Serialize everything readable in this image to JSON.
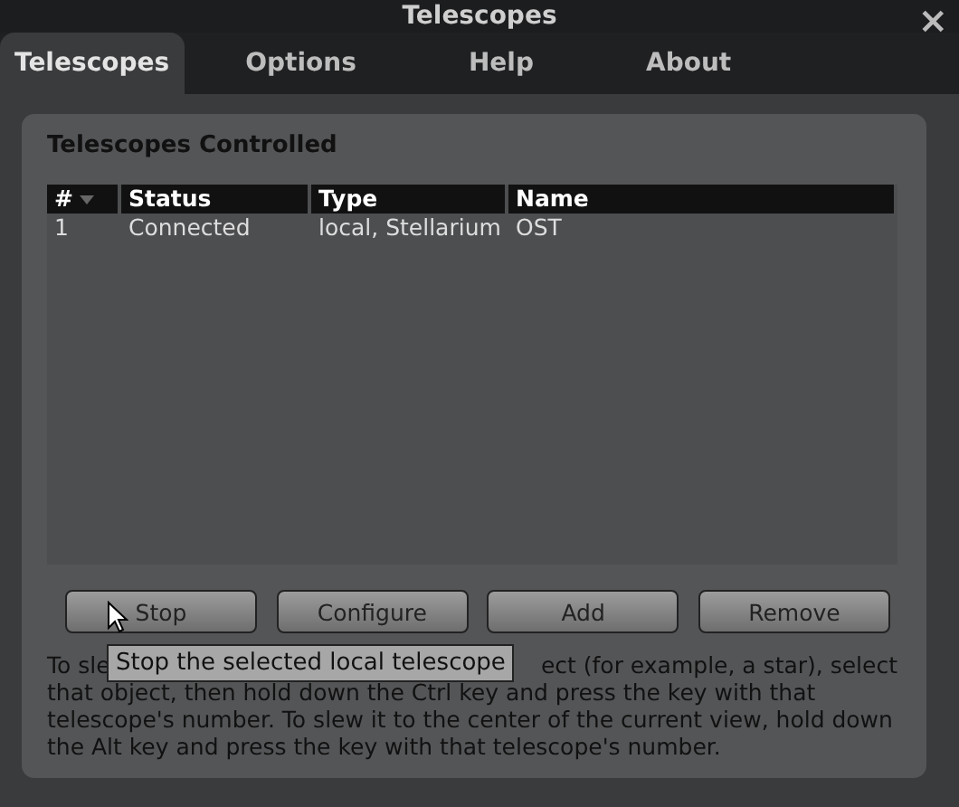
{
  "window": {
    "title": "Telescopes",
    "close": "×"
  },
  "tabs": [
    {
      "label": "Telescopes",
      "selected": true
    },
    {
      "label": "Options",
      "selected": false
    },
    {
      "label": "Help",
      "selected": false
    },
    {
      "label": "About",
      "selected": false
    }
  ],
  "panel": {
    "title": "Telescopes Controlled"
  },
  "table": {
    "columns": [
      {
        "label": "#",
        "sorted": true
      },
      {
        "label": "Status",
        "sorted": false
      },
      {
        "label": "Type",
        "sorted": false
      },
      {
        "label": "Name",
        "sorted": false
      }
    ],
    "rows": [
      [
        "1",
        "Connected",
        "local, Stellarium",
        "OST"
      ]
    ]
  },
  "buttons": [
    "Stop",
    "Configure",
    "Add",
    "Remove"
  ],
  "tooltip": "Stop the selected local telescope",
  "help_text": {
    "line_start": "To sle",
    "line_end": "ect (for example, a star), select",
    "rest": "that object, then hold down the Ctrl key and press the key with that telescope's number. To slew it to the center of the current view, hold down the Alt key and press the key with that telescope's number."
  }
}
